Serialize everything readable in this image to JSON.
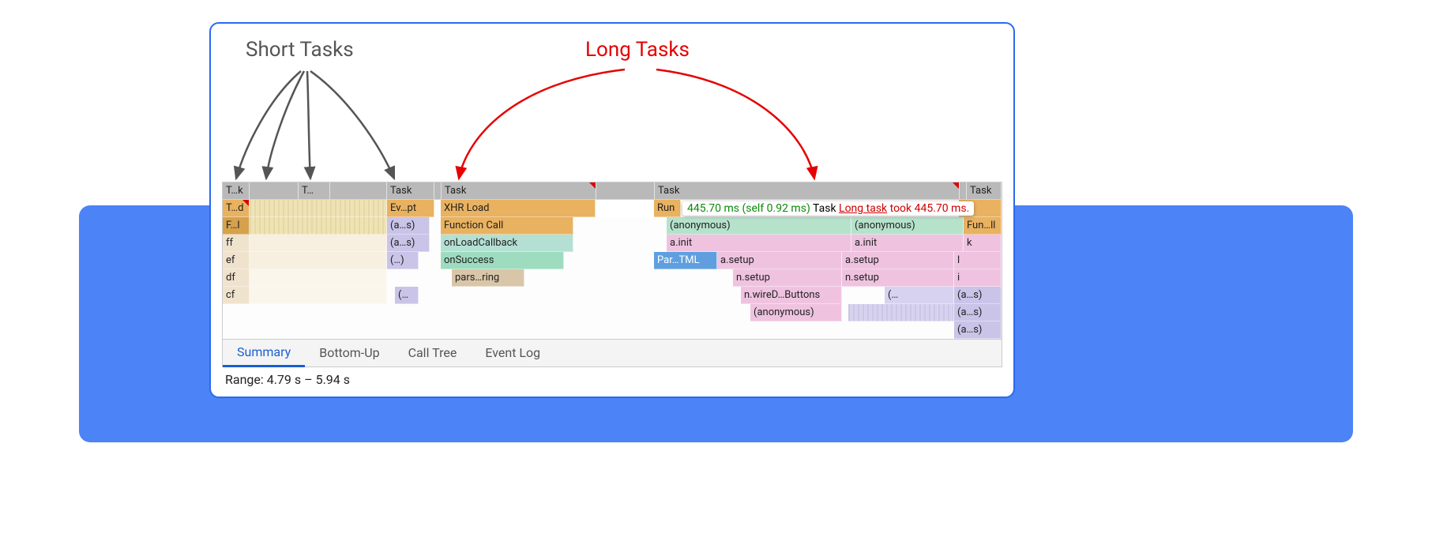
{
  "annotations": {
    "short": "Short Tasks",
    "long": "Long Tasks"
  },
  "taskRow": {
    "t1": "T…k",
    "t2": "T…",
    "t3": "Task",
    "t4": "Task",
    "t5": "Task",
    "t6": "Task"
  },
  "row2": {
    "c1": "T…d",
    "c2": "Ev…pt",
    "c3": "XHR Load",
    "c4": "Run"
  },
  "row3": {
    "c1": "F…l",
    "c2": "(a…s)",
    "c3": "Function Call",
    "c4": "(anonymous)",
    "c5": "(anonymous)",
    "c6": "Fun…ll"
  },
  "row4": {
    "c1": "ff",
    "c2": "(a…s)",
    "c3": "onLoadCallback",
    "c4": "a.init",
    "c5": "a.init",
    "c6": "k"
  },
  "row5": {
    "c1": "ef",
    "c2": "(…)",
    "c3": "onSuccess",
    "c4": "Par…TML",
    "c5": "a.setup",
    "c6": "a.setup",
    "c7": "l"
  },
  "row6": {
    "c1": "df",
    "c2": "pars…ring",
    "c3": "n.setup",
    "c4": "n.setup",
    "c5": "i"
  },
  "row7": {
    "c1": "cf",
    "c2": "(…",
    "c3": "n.wireD…Buttons",
    "c4": "(…",
    "c5": "(a…s)"
  },
  "row8": {
    "c1": "(anonymous)",
    "c2": "(a…s)"
  },
  "row9": {
    "c1": "(a…s)"
  },
  "tooltip": {
    "time": "445.70 ms (self 0.92 ms)",
    "label": "Task",
    "link": "Long task",
    "rest": "took 445.70 ms."
  },
  "tabs": [
    "Summary",
    "Bottom-Up",
    "Call Tree",
    "Event Log"
  ],
  "range": "Range: 4.79 s – 5.94 s"
}
